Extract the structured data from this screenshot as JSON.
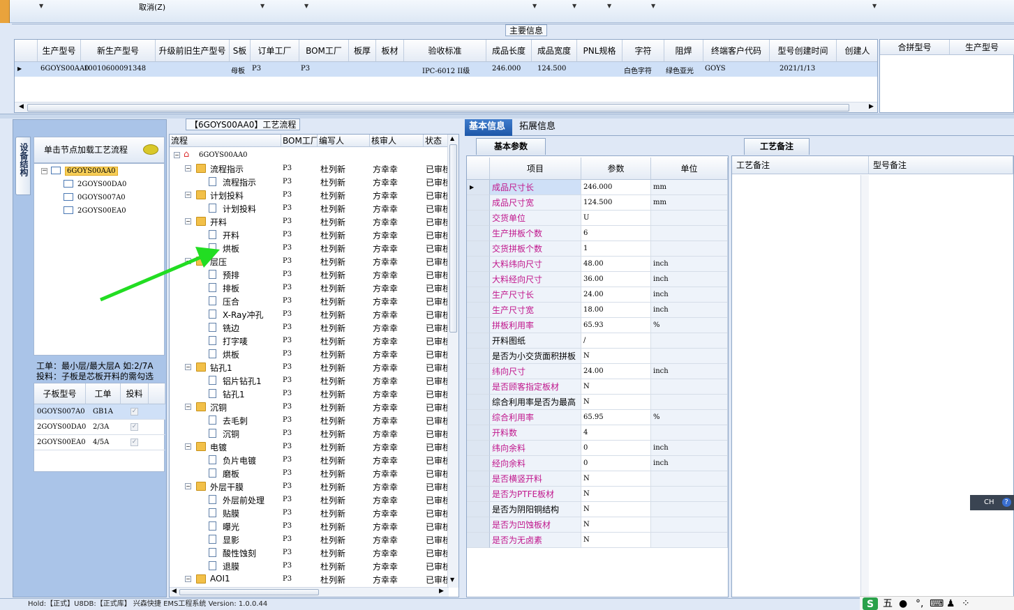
{
  "toolbar": {
    "cancel_label": "取消(Z)"
  },
  "main_group": {
    "title": "主要信息"
  },
  "main_grid": {
    "headers": [
      "生产型号",
      "新生产型号",
      "升级前旧生产型号",
      "S板",
      "订单工厂",
      "BOM工厂",
      "板厚",
      "板材",
      "验收标准",
      "成品长度",
      "成品宽度",
      "PNL规格",
      "字符",
      "阻焊",
      "终端客户代码",
      "型号创建时间",
      "创建人"
    ],
    "row": [
      "6GOYS00AA0",
      "10010600091348",
      "",
      "母板",
      "P3",
      "P3",
      "",
      "",
      "IPC-6012 II级",
      "246.000",
      "124.500",
      "",
      "白色字符",
      "绿色亚光",
      "GOYS",
      "2021/1/13",
      ""
    ]
  },
  "side_grid": {
    "headers": [
      "合拼型号",
      "生产型号"
    ]
  },
  "left_panel": {
    "vtab": "设备结构",
    "title": "单击节点加载工艺流程",
    "tree": [
      "6GOYS00AA0",
      "2GOYS00DA0",
      "0GOYS007A0",
      "2GOYS00EA0"
    ],
    "note1": "工单：最小层/最大层A 如:2/7A",
    "note2": "投料：子板是芯板开料的需勾选",
    "sub_headers": [
      "子板型号",
      "工单",
      "投料"
    ],
    "sub_rows": [
      {
        "model": "0GOYS007A0",
        "order": "GB1A"
      },
      {
        "model": "2GOYS00DA0",
        "order": "2/3A"
      },
      {
        "model": "2GOYS00EA0",
        "order": "4/5A"
      }
    ]
  },
  "flow": {
    "title": "【6GOYS00AA0】工艺流程",
    "headers": [
      "流程",
      "BOM工厂",
      "编写人",
      "核审人",
      "状态"
    ],
    "root": "6GOYS00AA0",
    "factory": "P3",
    "writer": "杜列新",
    "reviewer": "方幸幸",
    "status": "已审核",
    "rows": [
      {
        "name": "流程指示",
        "level": 1
      },
      {
        "name": "流程指示",
        "level": 2
      },
      {
        "name": "计划投料",
        "level": 1
      },
      {
        "name": "计划投料",
        "level": 2
      },
      {
        "name": "开料",
        "level": 1
      },
      {
        "name": "开料",
        "level": 2
      },
      {
        "name": "烘板",
        "level": 2
      },
      {
        "name": "层压",
        "level": 1
      },
      {
        "name": "预排",
        "level": 2
      },
      {
        "name": "排板",
        "level": 2
      },
      {
        "name": "压合",
        "level": 2
      },
      {
        "name": "X-Ray冲孔",
        "level": 2
      },
      {
        "name": "铣边",
        "level": 2
      },
      {
        "name": "打字唛",
        "level": 2
      },
      {
        "name": "烘板",
        "level": 2
      },
      {
        "name": "钻孔1",
        "level": 1
      },
      {
        "name": "铝片钻孔1",
        "level": 2
      },
      {
        "name": "钻孔1",
        "level": 2
      },
      {
        "name": "沉铜",
        "level": 1
      },
      {
        "name": "去毛刺",
        "level": 2
      },
      {
        "name": "沉铜",
        "level": 2
      },
      {
        "name": "电镀",
        "level": 1
      },
      {
        "name": "负片电镀",
        "level": 2
      },
      {
        "name": "磨板",
        "level": 2
      },
      {
        "name": "外层干膜",
        "level": 1
      },
      {
        "name": "外层前处理",
        "level": 2
      },
      {
        "name": "贴膜",
        "level": 2
      },
      {
        "name": "曝光",
        "level": 2
      },
      {
        "name": "显影",
        "level": 2
      },
      {
        "name": "酸性蚀刻",
        "level": 2
      },
      {
        "name": "退膜",
        "level": 2
      },
      {
        "name": "AOI1",
        "level": 1
      }
    ]
  },
  "tabs": [
    "基本信息",
    "拓展信息"
  ],
  "params": {
    "tab": "基本参数",
    "headers": [
      "项目",
      "参数",
      "单位"
    ],
    "rows": [
      {
        "item": "成品尺寸长",
        "value": "246.000",
        "unit": "mm",
        "pink": true
      },
      {
        "item": "成品尺寸宽",
        "value": "124.500",
        "unit": "mm",
        "pink": true
      },
      {
        "item": "交货单位",
        "value": "U",
        "unit": "",
        "pink": true
      },
      {
        "item": "生产拼板个数",
        "value": "6",
        "unit": "",
        "pink": true
      },
      {
        "item": "交货拼板个数",
        "value": "1",
        "unit": "",
        "pink": true
      },
      {
        "item": "大料纬向尺寸",
        "value": "48.00",
        "unit": "inch",
        "pink": true
      },
      {
        "item": "大料经向尺寸",
        "value": "36.00",
        "unit": "inch",
        "pink": true
      },
      {
        "item": "生产尺寸长",
        "value": "24.00",
        "unit": "inch",
        "pink": true
      },
      {
        "item": "生产尺寸宽",
        "value": "18.00",
        "unit": "inch",
        "pink": true
      },
      {
        "item": "拼板利用率",
        "value": "65.93",
        "unit": "%",
        "pink": true
      },
      {
        "item": "开料图纸",
        "value": "/",
        "unit": "",
        "pink": false
      },
      {
        "item": "是否为小交货面积拼板",
        "value": "N",
        "unit": "",
        "pink": false
      },
      {
        "item": "纬向尺寸",
        "value": "24.00",
        "unit": "inch",
        "pink": true
      },
      {
        "item": "是否顾客指定板材",
        "value": "N",
        "unit": "",
        "pink": true
      },
      {
        "item": "综合利用率是否为最高",
        "value": "N",
        "unit": "",
        "pink": false
      },
      {
        "item": "综合利用率",
        "value": "65.95",
        "unit": "%",
        "pink": true
      },
      {
        "item": "开料数",
        "value": "4",
        "unit": "",
        "pink": true
      },
      {
        "item": "纬向余料",
        "value": "0",
        "unit": "inch",
        "pink": true
      },
      {
        "item": "经向余料",
        "value": "0",
        "unit": "inch",
        "pink": true
      },
      {
        "item": "是否横竖开料",
        "value": "N",
        "unit": "",
        "pink": true
      },
      {
        "item": "是否为PTFE板材",
        "value": "N",
        "unit": "",
        "pink": true
      },
      {
        "item": "是否为阴阳铜结构",
        "value": "N",
        "unit": "",
        "pink": false
      },
      {
        "item": "是否为凹蚀板材",
        "value": "N",
        "unit": "",
        "pink": true
      },
      {
        "item": "是否为无卤素",
        "value": "N",
        "unit": "",
        "pink": true
      }
    ]
  },
  "notes": {
    "tab": "工艺备注",
    "headers": [
      "工艺备注",
      "型号备注"
    ]
  },
  "statusbar": {
    "text": "Hold:【正式】U8DB:【正式库】        兴森快捷 EMS工程系统 Version: 1.0.0.44"
  },
  "ime": {
    "label": "CH",
    "bar": "五"
  },
  "colors": {
    "pink": "#c0168c",
    "selected_row": "#cfe0f7",
    "tab_active": "#1e57a8",
    "arrow": "#22dd22"
  }
}
